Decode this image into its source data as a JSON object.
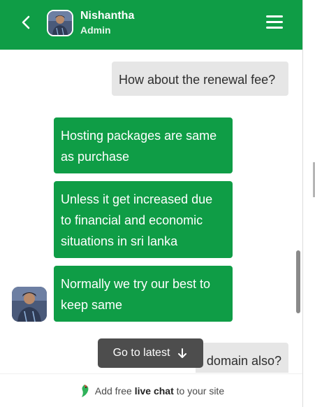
{
  "header": {
    "agent_name": "Nishantha",
    "agent_role": "Admin",
    "icons": {
      "back": "chevron-left-icon",
      "menu": "hamburger-menu-icon"
    }
  },
  "messages": [
    {
      "from": "visitor",
      "text": "How about the renewal fee?"
    },
    {
      "from": "agent",
      "text": "Hosting packages are same as purchase"
    },
    {
      "from": "agent",
      "text": "Unless it get increased due to financial and economic situations in sri lanka"
    },
    {
      "from": "agent",
      "text": "Normally we try our best to keep same"
    },
    {
      "from": "visitor",
      "text": "domain also?"
    }
  ],
  "go_latest": {
    "label": "Go to latest",
    "icon": "arrow-down-icon"
  },
  "footer": {
    "prefix": "Add free ",
    "bold": "live chat",
    "suffix": " to your site",
    "icon": "parrot-logo-icon"
  },
  "colors": {
    "brand": "#0f9d46",
    "visitor_bubble": "#e6e6e6",
    "tooltip": "#4d4d4d"
  }
}
